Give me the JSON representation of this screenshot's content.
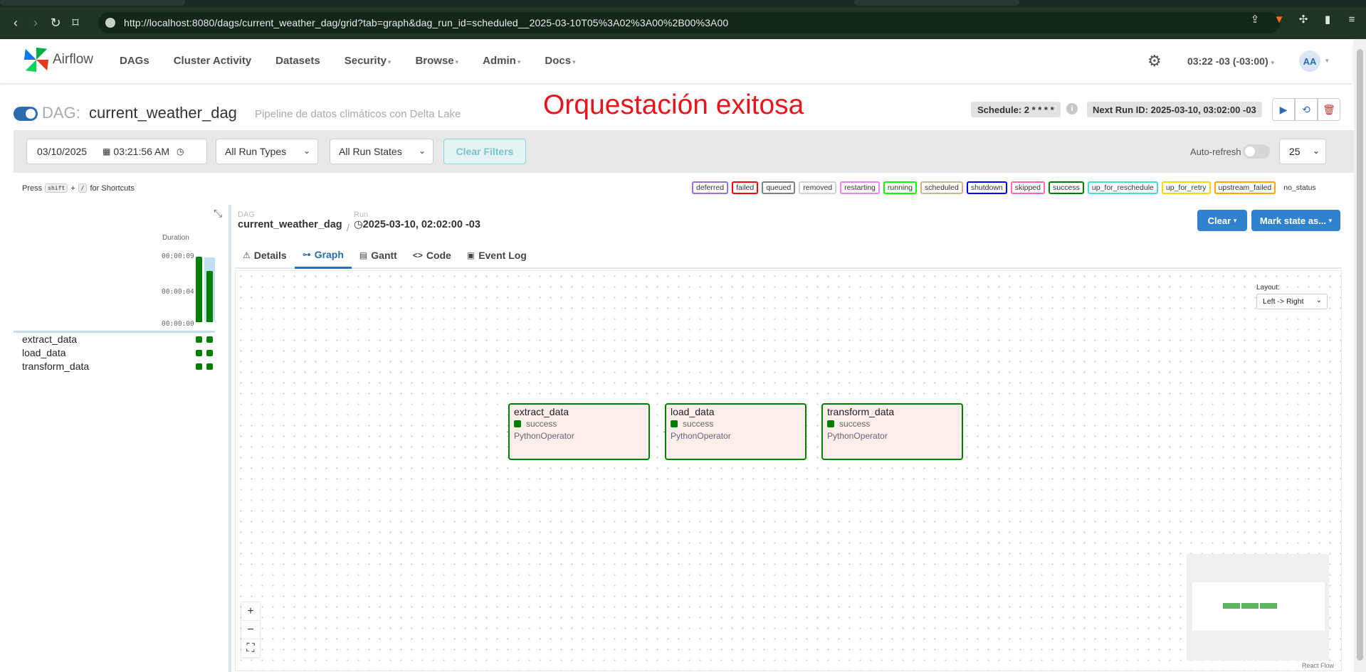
{
  "browser": {
    "url": "http://localhost:8080/dags/current_weather_dag/grid?tab=graph&dag_run_id=scheduled__2025-03-10T05%3A02%3A00%2B00%3A00",
    "icons": [
      "back-icon",
      "forward-icon",
      "reload-icon",
      "bookmark-icon",
      "share-icon",
      "brave-shield-icon",
      "extensions-icon",
      "sidebar-icon",
      "menu-icon"
    ]
  },
  "navbar": {
    "brand": "Airflow",
    "items": [
      {
        "label": "DAGs",
        "dropdown": false
      },
      {
        "label": "Cluster Activity",
        "dropdown": false
      },
      {
        "label": "Datasets",
        "dropdown": false
      },
      {
        "label": "Security",
        "dropdown": true
      },
      {
        "label": "Browse",
        "dropdown": true
      },
      {
        "label": "Admin",
        "dropdown": true
      },
      {
        "label": "Docs",
        "dropdown": true
      }
    ],
    "time": "03:22 -03 (-03:00)",
    "avatar": "AA"
  },
  "dag": {
    "prefix": "DAG:",
    "name": "current_weather_dag",
    "description": "Pipeline de datos climáticos con Delta Lake",
    "schedule": "Schedule: 2 * * * *",
    "next_run": "Next Run ID: 2025-03-10, 03:02:00 -03"
  },
  "annotation": "Orquestación exitosa",
  "filters": {
    "date": "03/10/2025",
    "time": "03:21:56 AM",
    "run_types": "All Run Types",
    "run_states": "All Run States",
    "clear_filters": "Clear Filters",
    "auto_refresh": "Auto-refresh",
    "page_size": "25"
  },
  "shortcut": {
    "press": "Press",
    "key1": "shift",
    "plus": "+",
    "key2": "/",
    "suffix": "for Shortcuts"
  },
  "states": [
    {
      "name": "deferred",
      "color": "#9370db"
    },
    {
      "name": "failed",
      "color": "#ff0000"
    },
    {
      "name": "queued",
      "color": "#808080"
    },
    {
      "name": "removed",
      "color": "#d3d3d3"
    },
    {
      "name": "restarting",
      "color": "#ee82ee"
    },
    {
      "name": "running",
      "color": "#00ff00"
    },
    {
      "name": "scheduled",
      "color": "#d2b48c"
    },
    {
      "name": "shutdown",
      "color": "#0000ff"
    },
    {
      "name": "skipped",
      "color": "#ff69b4"
    },
    {
      "name": "success",
      "color": "#008000"
    },
    {
      "name": "up_for_reschedule",
      "color": "#40e0d0"
    },
    {
      "name": "up_for_retry",
      "color": "#ffd700"
    },
    {
      "name": "upstream_failed",
      "color": "#ffa500"
    },
    {
      "name": "no_status",
      "color": "#ffffff"
    }
  ],
  "grid": {
    "duration_label": "Duration",
    "ticks": [
      "00:00:09",
      "00:00:04",
      "00:00:00"
    ],
    "run_durations_sec": [
      9,
      7
    ],
    "max_sec": 9,
    "tasks": [
      "extract_data",
      "load_data",
      "transform_data"
    ]
  },
  "details": {
    "dag_label": "DAG",
    "dag_value": "current_weather_dag",
    "run_label": "Run",
    "run_value": "2025-03-10, 02:02:00 -03",
    "clear_label": "Clear",
    "mark_label": "Mark state as...",
    "tabs": [
      {
        "label": "Details",
        "icon": "warning-icon",
        "active": false
      },
      {
        "label": "Graph",
        "icon": "graph-icon",
        "active": true
      },
      {
        "label": "Gantt",
        "icon": "gantt-icon",
        "active": false
      },
      {
        "label": "Code",
        "icon": "code-icon",
        "active": false
      },
      {
        "label": "Event Log",
        "icon": "event-log-icon",
        "active": false
      }
    ]
  },
  "graph": {
    "layout_label": "Layout:",
    "layout_value": "Left -> Right",
    "nodes": [
      {
        "name": "extract_data",
        "state": "success",
        "operator": "PythonOperator"
      },
      {
        "name": "load_data",
        "state": "success",
        "operator": "PythonOperator"
      },
      {
        "name": "transform_data",
        "state": "success",
        "operator": "PythonOperator"
      }
    ],
    "attribution": "React Flow"
  }
}
